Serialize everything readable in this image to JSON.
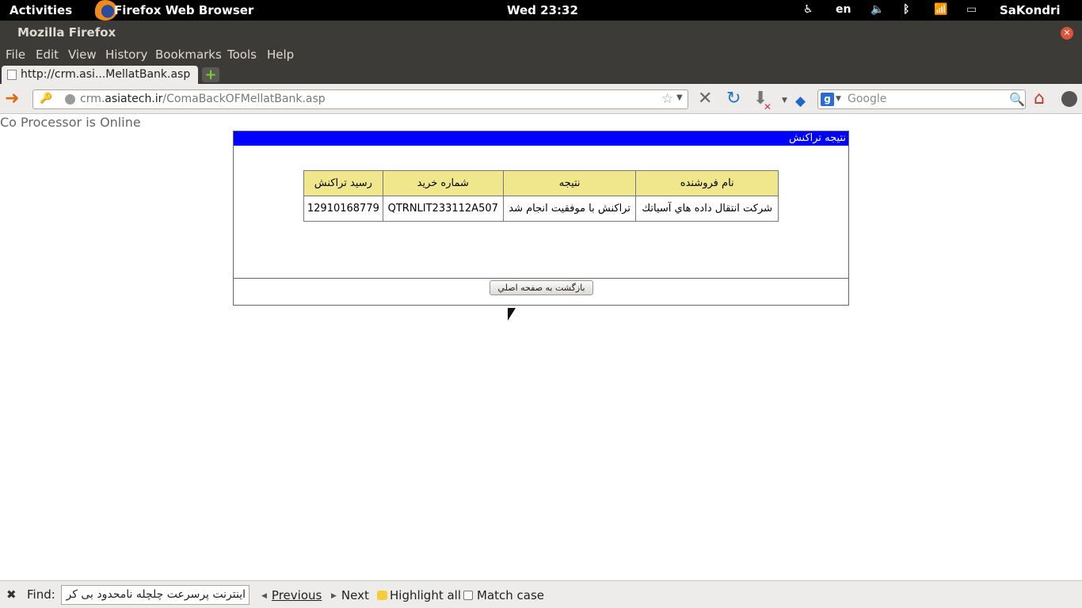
{
  "top_panel": {
    "activities": "Activities",
    "app_name": "Firefox Web Browser",
    "clock": "Wed 23:32",
    "keyboard_layout": "en",
    "user": "SaKondri"
  },
  "window": {
    "title": "Mozilla Firefox"
  },
  "menubar": {
    "items": [
      "File",
      "Edit",
      "View",
      "History",
      "Bookmarks",
      "Tools",
      "Help"
    ]
  },
  "tab": {
    "title": "http://crm.asi...MellatBank.asp"
  },
  "navbar": {
    "url_prefix": "crm.",
    "url_domain": "asiatech.ir",
    "url_path": "/ComaBackOFMellatBank.asp",
    "search_engine_icon": "g",
    "search_placeholder": "Google"
  },
  "page": {
    "status": "Co Processor is Online",
    "panel_header": "نتيجه تراكنش",
    "table": {
      "headers": [
        "نام فروشنده",
        "نتيجه",
        "شماره خريد",
        "رسيد تراكنش"
      ],
      "row": [
        "شركت انتقال داده هاي آسياتك",
        "تراكنش با موفقيت انجام شد",
        "QTRNLIT233112A507",
        "12910168779"
      ]
    },
    "back_button": "بازگشت به صفحه اصلي"
  },
  "findbar": {
    "label": "Find:",
    "query": "اینترنت پرسرعت چلچله نامحدود بی کر",
    "previous": "Previous",
    "next": "Next",
    "highlight_all": "Highlight all",
    "match_case": "Match case"
  },
  "colors": {
    "panel_header_bg": "#0000ff",
    "table_header_bg": "#f0e68c",
    "chrome_bg": "#3c3b37"
  }
}
